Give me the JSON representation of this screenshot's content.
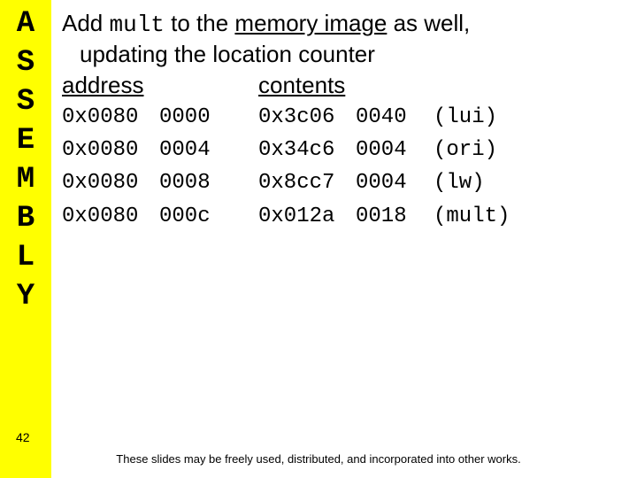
{
  "sidebar": {
    "label": "ASSEMBLY"
  },
  "heading": {
    "pre": "Add ",
    "mono": "mult",
    "mid1": " to the ",
    "ul": "memory image",
    "mid2": " as well,",
    "line2": "updating the location counter"
  },
  "columns": {
    "address": "address",
    "contents": "contents"
  },
  "rows": [
    {
      "a1": "0x0080",
      "a2": "0000",
      "h1": "0x3c06",
      "h2": "0040",
      "instr": "(lui)"
    },
    {
      "a1": "0x0080",
      "a2": "0004",
      "h1": "0x34c6",
      "h2": "0004",
      "instr": "(ori)"
    },
    {
      "a1": "0x0080",
      "a2": "0008",
      "h1": "0x8cc7",
      "h2": "0004",
      "instr": "(lw)"
    },
    {
      "a1": "0x0080",
      "a2": "000c",
      "h1": "0x012a",
      "h2": "0018",
      "instr": "(mult)"
    }
  ],
  "page_number": "42",
  "footer": "These slides may be freely used, distributed, and incorporated into other works."
}
